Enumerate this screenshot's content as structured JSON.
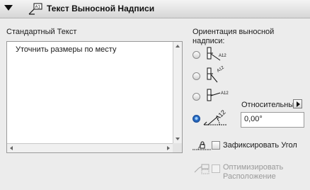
{
  "header": {
    "title": "Текст Выносной Надписи",
    "icon": "label-marker-icon"
  },
  "text_section": {
    "label": "Стандартный Текст",
    "value": "Уточнить размеры по месту"
  },
  "orientation": {
    "label_line1": "Ориентация выносной",
    "label_line2": "надписи:",
    "options": [
      {
        "icon": "orient-vertical-icon",
        "selected": false
      },
      {
        "icon": "orient-rotated-icon",
        "selected": false
      },
      {
        "icon": "orient-horizontal-icon",
        "selected": false
      },
      {
        "icon": "orient-relative-angle-icon",
        "selected": true
      }
    ],
    "relative_label": "Относительный",
    "angle_value": "0,00°"
  },
  "fix_angle": {
    "label": "Зафиксировать Угол",
    "checked": false
  },
  "optimize": {
    "label_line1": "Оптимизировать",
    "label_line2": "Расположение",
    "checked": false,
    "enabled": false
  },
  "colors": {
    "panel": "#ececec",
    "radio_selected": "#2a6fc8"
  }
}
